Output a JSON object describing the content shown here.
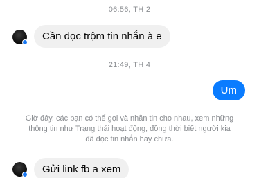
{
  "timestamps": {
    "first": "06:56, TH 2",
    "second": "21:49, TH 4"
  },
  "messages": [
    {
      "sender": "other",
      "text": "Cần đọc trộm tin nhắn à e"
    },
    {
      "sender": "me",
      "text": "Um"
    },
    {
      "sender": "other",
      "text": "Gửi link fb a xem"
    }
  ],
  "notice": {
    "line1": "Giờ đây, các bạn có thể gọi và nhắn tin cho nhau, xem những",
    "line2": "thông tin như Trạng thái hoạt động, đồng thời biết người kia",
    "line3": "đã đọc tin nhắn hay chưa."
  },
  "colors": {
    "outgoing_bubble": "#0a7cff",
    "incoming_bubble": "#f0f0f0",
    "meta_text": "#8a8d91",
    "online_dot": "#1877f2"
  }
}
